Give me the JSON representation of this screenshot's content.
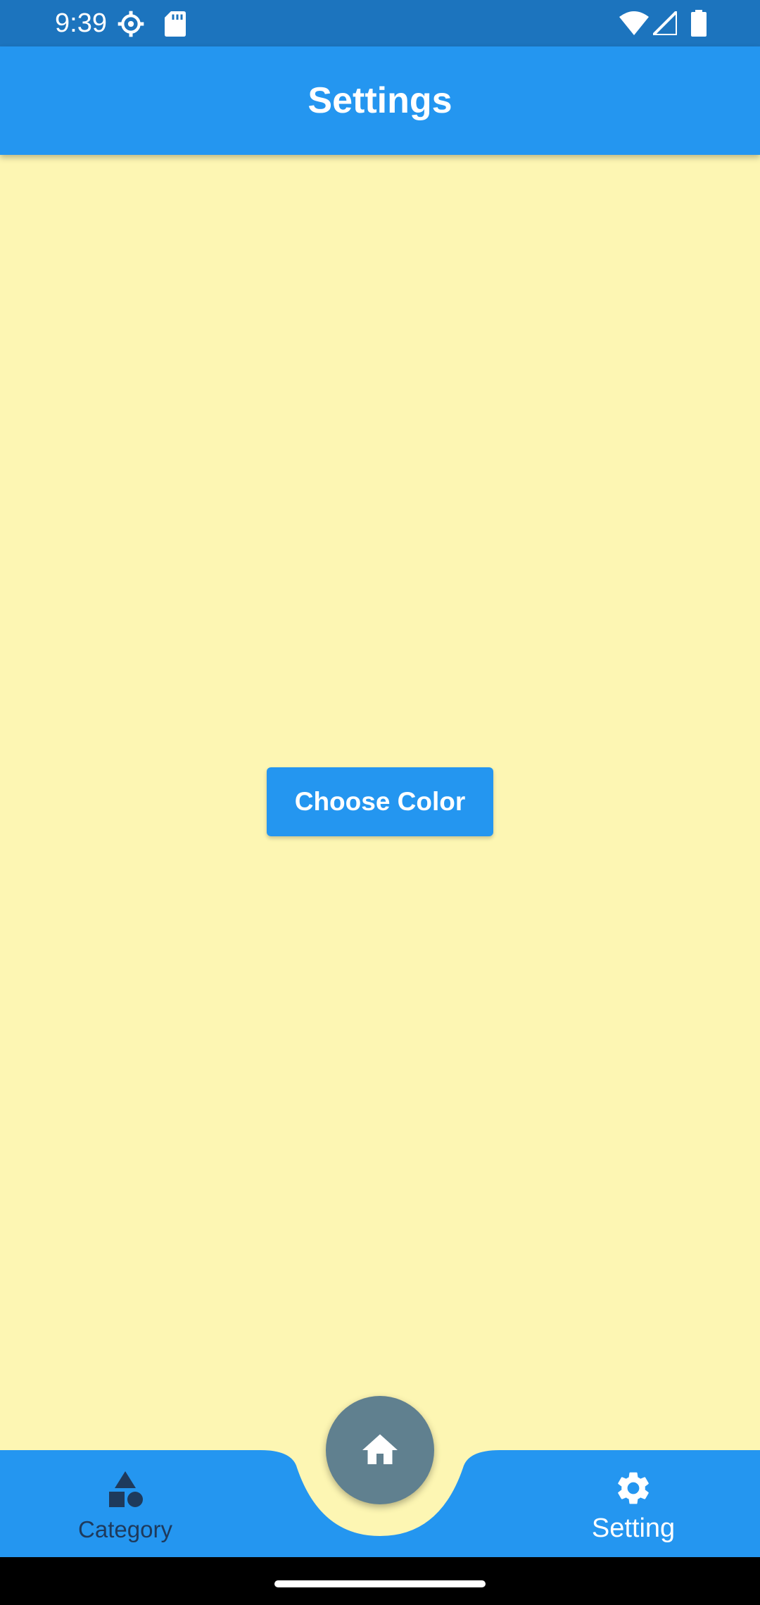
{
  "status_bar": {
    "time": "9:39",
    "icons": [
      "settings-gear-icon",
      "sd-card-icon",
      "wifi-icon",
      "cell-signal-icon",
      "battery-icon"
    ]
  },
  "app_bar": {
    "title": "Settings",
    "color": "#2496F0"
  },
  "main": {
    "background_color": "#FDF6B3",
    "choose_color_label": "Choose Color"
  },
  "bottom_nav": {
    "items": [
      {
        "label": "Category",
        "icon": "category-shapes-icon",
        "selected": false
      },
      {
        "label": "Setting",
        "icon": "gear-icon",
        "selected": true
      }
    ],
    "fab_icon": "home-icon",
    "bar_color": "#2496F0",
    "fab_color": "#60808F"
  }
}
